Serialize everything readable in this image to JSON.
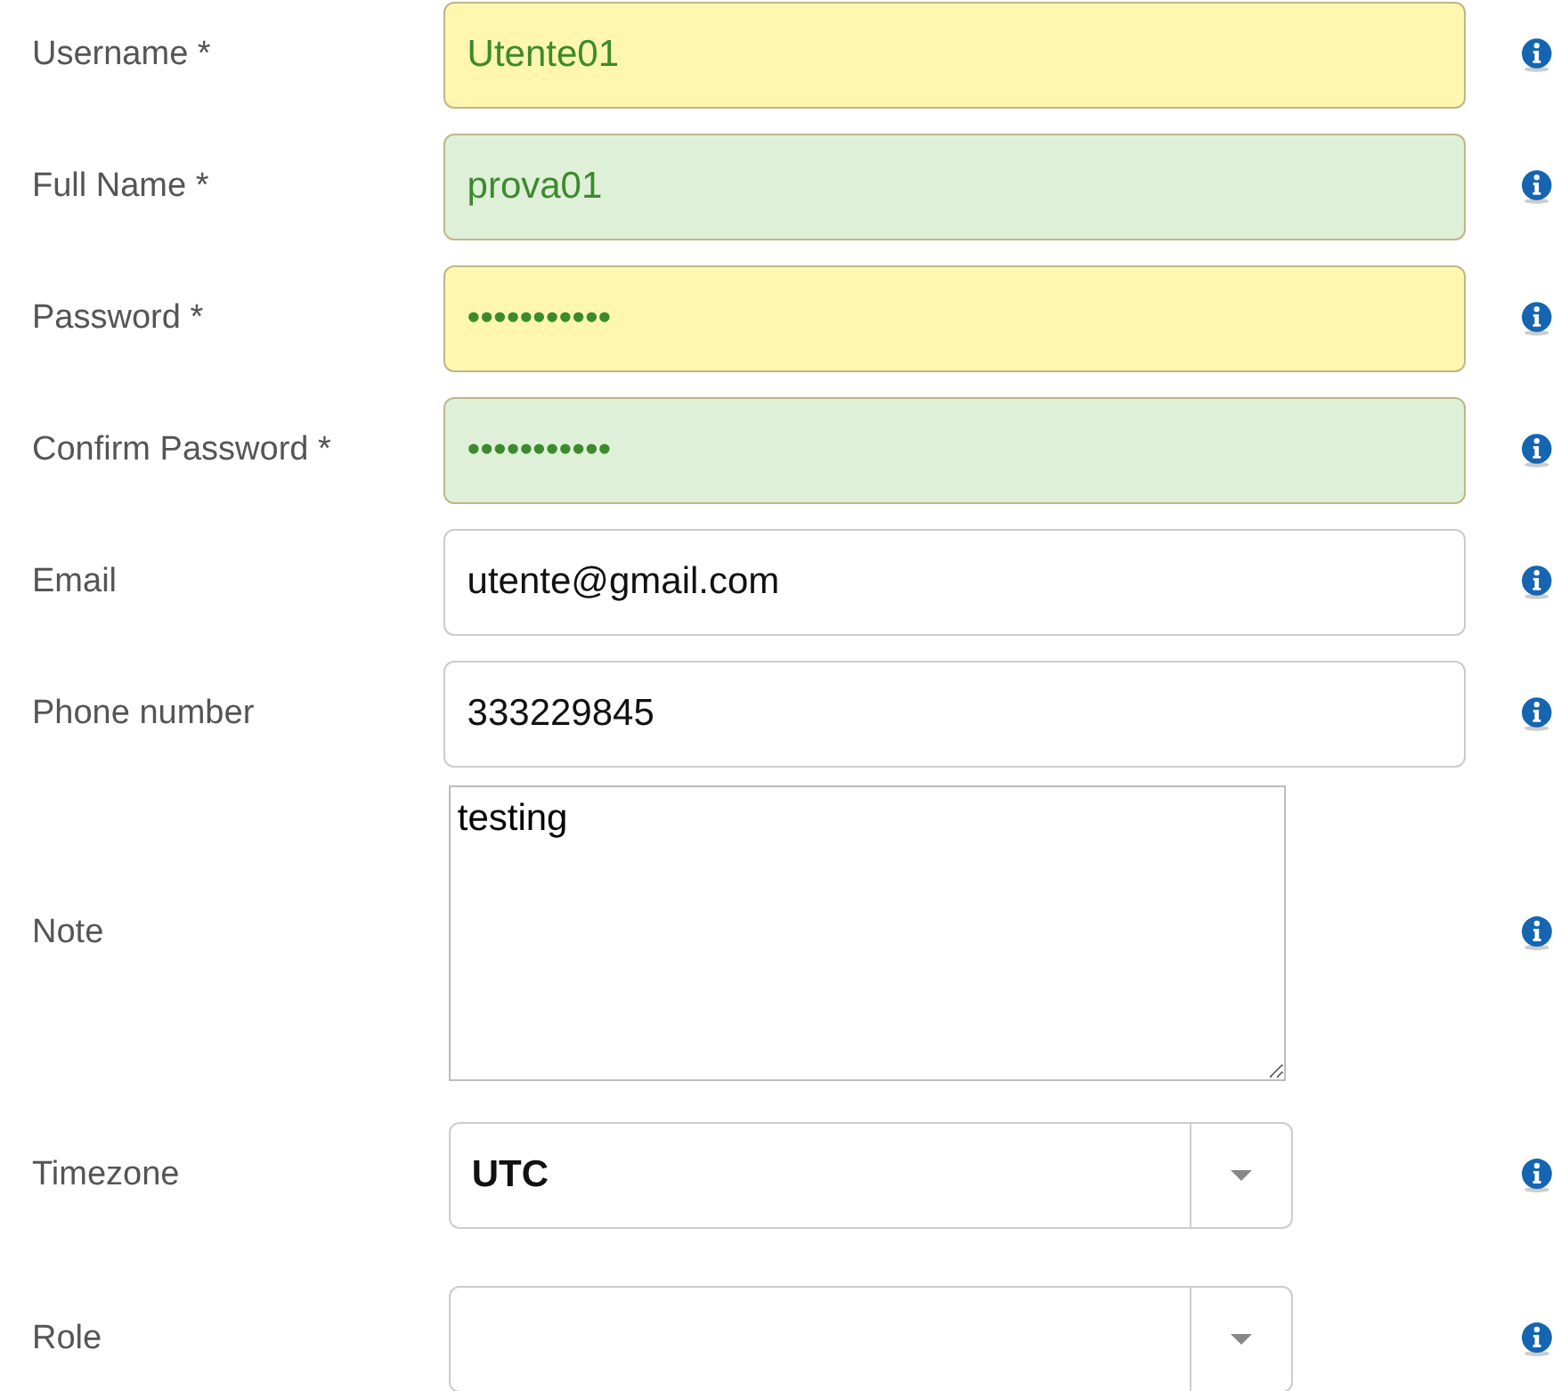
{
  "fields": [
    {
      "label": "Username *",
      "kind": "text",
      "value": "Utente01",
      "color": "#fff7b0"
    },
    {
      "label": "Full Name *",
      "kind": "text",
      "value": "prova01",
      "color": "#dff0d8"
    },
    {
      "label": "Password *",
      "kind": "password",
      "value": "•••••••••••",
      "color": "#fff7b0"
    },
    {
      "label": "Confirm Password *",
      "kind": "password",
      "value": "•••••••••••",
      "color": "#dff0d8"
    },
    {
      "label": "Email",
      "kind": "text",
      "value": "utente@gmail.com"
    },
    {
      "label": "Phone number",
      "kind": "text",
      "value": "333229845"
    },
    {
      "label": "Note",
      "kind": "textarea",
      "value": "testing"
    },
    {
      "label": "Timezone",
      "kind": "select",
      "value": "UTC"
    },
    {
      "label": "Role",
      "kind": "select"
    }
  ]
}
